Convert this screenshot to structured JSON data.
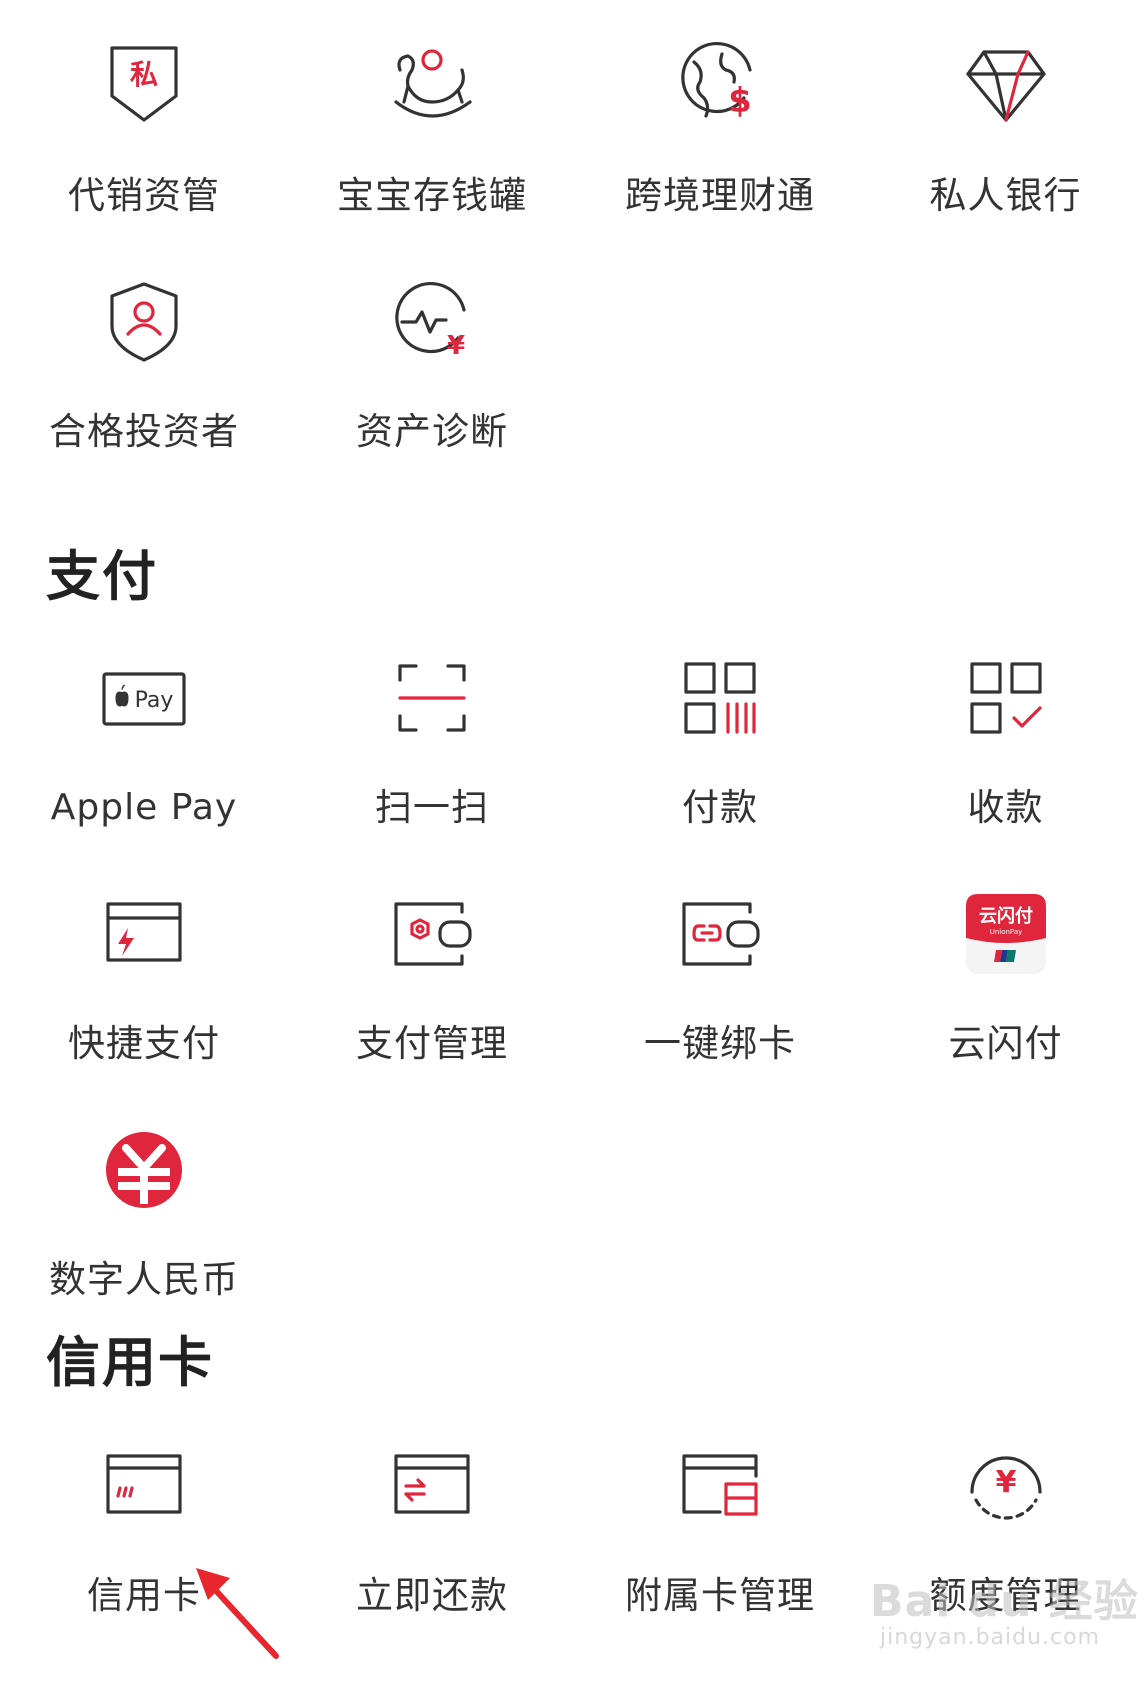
{
  "wealth": {
    "items": [
      {
        "label": "代销资管",
        "icon": "private-shield-icon",
        "glyph": "私"
      },
      {
        "label": "宝宝存钱罐",
        "icon": "rocking-horse-icon"
      },
      {
        "label": "跨境理财通",
        "icon": "globe-dollar-icon",
        "glyph": "$"
      },
      {
        "label": "私人银行",
        "icon": "diamond-icon"
      },
      {
        "label": "合格投资者",
        "icon": "user-shield-icon"
      },
      {
        "label": "资产诊断",
        "icon": "pulse-yuan-icon",
        "glyph": "¥"
      }
    ]
  },
  "payment": {
    "title": "支付",
    "items": [
      {
        "label": "Apple Pay",
        "icon": "apple-pay-icon",
        "glyph": "Pay"
      },
      {
        "label": "扫一扫",
        "icon": "scan-icon"
      },
      {
        "label": "付款",
        "icon": "pay-code-icon"
      },
      {
        "label": "收款",
        "icon": "receive-code-icon"
      },
      {
        "label": "快捷支付",
        "icon": "quick-pay-card-icon"
      },
      {
        "label": "支付管理",
        "icon": "wallet-settings-icon"
      },
      {
        "label": "一键绑卡",
        "icon": "wallet-link-icon"
      },
      {
        "label": "云闪付",
        "icon": "unionpay-quickpass-icon",
        "glyph": "云闪付",
        "glyph_sub": "UnionPay"
      },
      {
        "label": "数字人民币",
        "icon": "digital-rmb-icon"
      }
    ]
  },
  "credit": {
    "title": "信用卡",
    "items": [
      {
        "label": "信用卡",
        "icon": "credit-card-icon"
      },
      {
        "label": "立即还款",
        "icon": "repay-card-icon"
      },
      {
        "label": "附属卡管理",
        "icon": "supplementary-card-icon"
      },
      {
        "label": "额度管理",
        "icon": "limit-yuan-icon",
        "glyph": "¥"
      }
    ]
  },
  "watermark": {
    "text": "Bai du 经验",
    "sub": "jingyan.baidu.com"
  },
  "colors": {
    "accent": "#e0263c",
    "icon_stroke": "#333333",
    "text": "#333333"
  }
}
